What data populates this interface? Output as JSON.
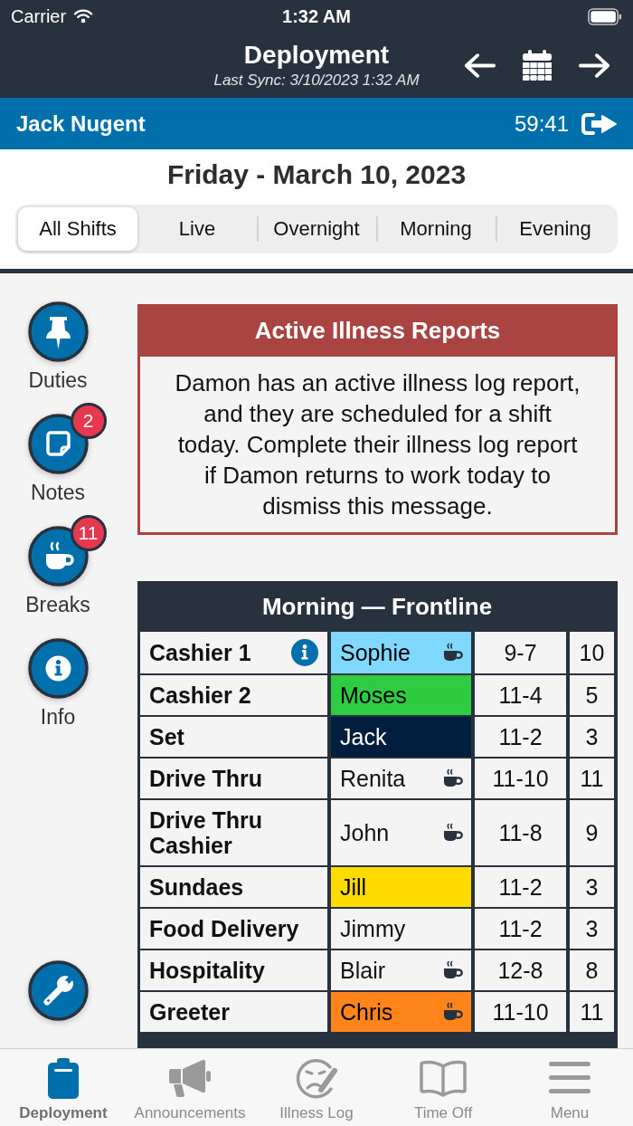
{
  "status_bar": {
    "carrier": "Carrier",
    "time": "1:32 AM"
  },
  "nav_bar": {
    "title": "Deployment",
    "subtitle": "Last Sync: 3/10/2023 1:32 AM"
  },
  "user_bar": {
    "name": "Jack Nugent",
    "timer": "59:41"
  },
  "date_heading": "Friday - March 10, 2023",
  "shift_tabs": [
    {
      "label": "All Shifts",
      "selected": true
    },
    {
      "label": "Live",
      "selected": false
    },
    {
      "label": "Overnight",
      "selected": false
    },
    {
      "label": "Morning",
      "selected": false
    },
    {
      "label": "Evening",
      "selected": false
    }
  ],
  "side_actions": [
    {
      "label": "Duties"
    },
    {
      "label": "Notes",
      "badge": "2"
    },
    {
      "label": "Breaks",
      "badge": "11"
    },
    {
      "label": "Info"
    }
  ],
  "illness_alert": {
    "title": "Active Illness Reports",
    "message": "Damon has an active illness log report, and they are scheduled for a shift today. Complete their illness log report if Damon returns to work today to dismiss this message."
  },
  "deployment_table": {
    "title": "Morning — Frontline",
    "rows": [
      {
        "position": "Cashier 1",
        "has_info": true,
        "employee": "Sophie",
        "color": "#80d8ff",
        "on_break": true,
        "shift": "9-7",
        "hours": "10"
      },
      {
        "position": "Cashier 2",
        "has_info": false,
        "employee": "Moses",
        "color": "#2ecc40",
        "on_break": false,
        "shift": "11-4",
        "hours": "5"
      },
      {
        "position": "Set",
        "has_info": false,
        "employee": "Jack",
        "color": "#001f3f",
        "on_break": false,
        "shift": "11-2",
        "hours": "3"
      },
      {
        "position": "Drive Thru",
        "has_info": false,
        "employee": "Renita",
        "on_break": true,
        "shift": "11-10",
        "hours": "11"
      },
      {
        "position": "Drive Thru Cashier",
        "has_info": false,
        "employee": "John",
        "on_break": true,
        "shift": "11-8",
        "hours": "9"
      },
      {
        "position": "Sundaes",
        "has_info": false,
        "employee": "Jill",
        "color": "#ffdc00",
        "on_break": false,
        "shift": "11-2",
        "hours": "3"
      },
      {
        "position": "Food Delivery",
        "has_info": false,
        "employee": "Jimmy",
        "on_break": false,
        "shift": "11-2",
        "hours": "3"
      },
      {
        "position": "Hospitality",
        "has_info": false,
        "employee": "Blair",
        "on_break": true,
        "shift": "12-8",
        "hours": "8"
      },
      {
        "position": "Greeter",
        "has_info": false,
        "employee": "Chris",
        "color": "#ff851b",
        "on_break": true,
        "shift": "11-10",
        "hours": "11"
      }
    ]
  },
  "bottom_tabs": [
    {
      "label": "Deployment",
      "selected": true
    },
    {
      "label": "Announcements",
      "selected": false
    },
    {
      "label": "Illness Log",
      "selected": false
    },
    {
      "label": "Time Off",
      "selected": false
    },
    {
      "label": "Menu",
      "selected": false
    }
  ]
}
